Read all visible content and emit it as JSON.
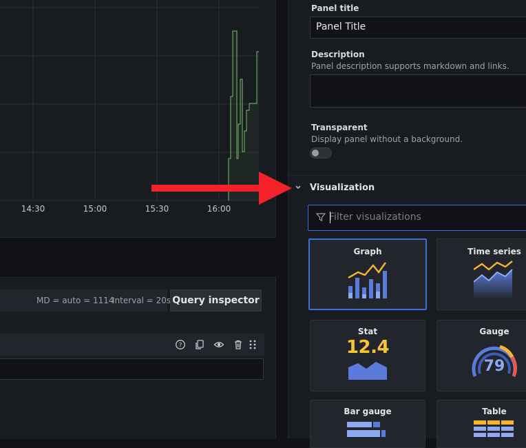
{
  "graph": {
    "x_ticks": [
      "14:30",
      "15:00",
      "15:30",
      "16:00"
    ],
    "line_color": "#73bf69"
  },
  "query": {
    "md_text": "MD = auto = 1114",
    "interval_text": "Interval = 20s",
    "inspector_label": "Query inspector"
  },
  "options": {
    "panel_title_label": "Panel title",
    "panel_title_value": "Panel Title",
    "description_label": "Description",
    "description_hint": "Panel description supports markdown and links.",
    "transparent_label": "Transparent",
    "transparent_hint": "Display panel without a background."
  },
  "visualization": {
    "header": "Visualization",
    "filter_placeholder": "Filter visualizations",
    "cards": [
      {
        "name": "Graph",
        "selected": true
      },
      {
        "name": "Time series",
        "selected": false
      },
      {
        "name": "Stat",
        "selected": false,
        "icon_value": "12.4"
      },
      {
        "name": "Gauge",
        "selected": false,
        "icon_value": "79"
      },
      {
        "name": "Bar gauge",
        "selected": false
      },
      {
        "name": "Table",
        "selected": false
      }
    ]
  },
  "colors": {
    "accent_blue": "#3d71d9",
    "annotation_red": "#f2212a"
  }
}
